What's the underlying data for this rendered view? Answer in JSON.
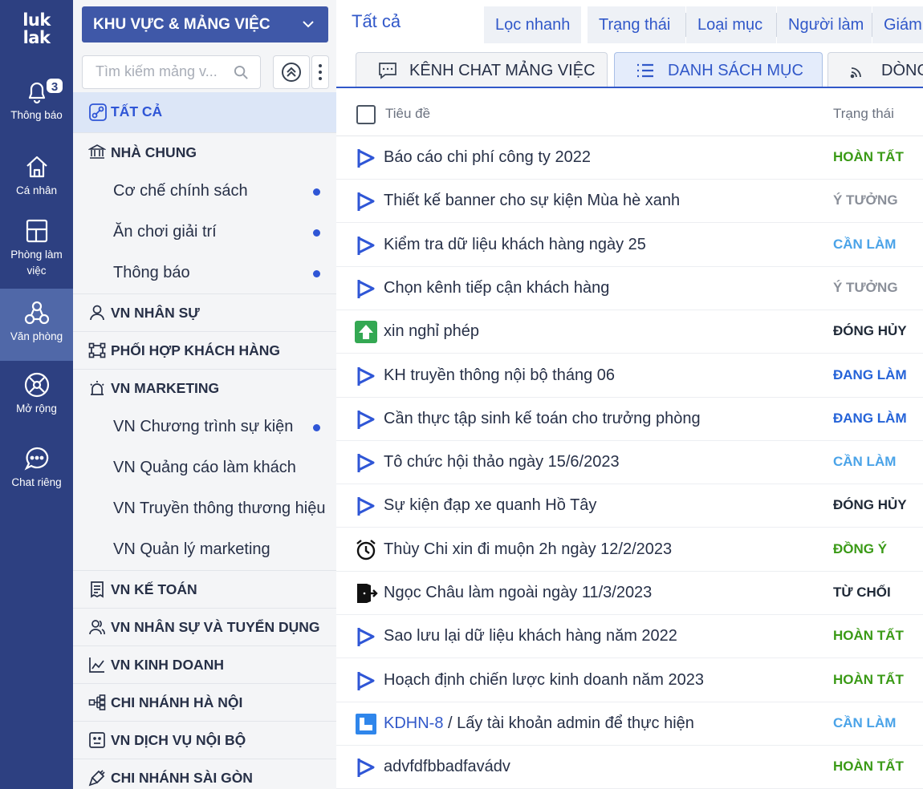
{
  "rail": {
    "logo_line1": "luk",
    "logo_line2": "lak",
    "notifications_badge": "3",
    "items": [
      {
        "label": "Thông báo",
        "icon": "bell-icon"
      },
      {
        "label": "Cá nhân",
        "icon": "home-icon"
      },
      {
        "label": "Phòng làm việc",
        "label_line1": "Phòng làm",
        "label_line2": "việc",
        "icon": "workspace-icon"
      },
      {
        "label": "Văn phòng",
        "icon": "office-icon",
        "active": true
      },
      {
        "label": "Mở rộng",
        "icon": "extend-icon"
      },
      {
        "label": "Chat riêng",
        "icon": "chat-icon"
      }
    ]
  },
  "sidebar": {
    "area_select_label": "KHU VỰC & MẢNG VIỆC",
    "search_placeholder": "Tìm kiếm mảng v...",
    "tree": [
      {
        "type": "group",
        "label": "TẤT CẢ",
        "icon": "link-icon",
        "selected": true
      },
      {
        "type": "group",
        "label": "NHÀ CHUNG",
        "icon": "bank-icon"
      },
      {
        "type": "child",
        "label": "Cơ chế chính sách",
        "dot": true
      },
      {
        "type": "child",
        "label": "Ăn chơi giải trí",
        "dot": true
      },
      {
        "type": "child",
        "label": "Thông báo",
        "dot": true
      },
      {
        "type": "group",
        "label": "VN NHÂN SỰ",
        "icon": "user-icon"
      },
      {
        "type": "group",
        "label": "PHỐI HỢP KHÁCH HÀNG",
        "icon": "collab-icon"
      },
      {
        "type": "group",
        "label": "VN MARKETING",
        "icon": "alarm-light-icon"
      },
      {
        "type": "child",
        "label": "VN Chương trình sự kiện",
        "dot": true
      },
      {
        "type": "child",
        "label": "VN Quảng cáo làm khách",
        "dot": false
      },
      {
        "type": "child",
        "label": "VN Truyền thông thương hiệu",
        "dot": false
      },
      {
        "type": "child",
        "label": "VN Quản lý marketing",
        "dot": false
      },
      {
        "type": "group",
        "label": "VN KẾ TOÁN",
        "icon": "receipt-icon"
      },
      {
        "type": "group",
        "label": "VN NHÂN SỰ VÀ TUYỂN DỤNG",
        "icon": "users-icon"
      },
      {
        "type": "group",
        "label": "VN KINH DOANH",
        "icon": "chart-line-icon"
      },
      {
        "type": "group",
        "label": "CHI NHÁNH HÀ NỘI",
        "icon": "org-chart-icon"
      },
      {
        "type": "group",
        "label": "VN DỊCH VỤ NỘI BỘ",
        "icon": "service-icon"
      },
      {
        "type": "group",
        "label": "CHI NHÁNH SÀI GÒN",
        "icon": "plug-icon"
      }
    ]
  },
  "main": {
    "filter_title": "Tất cả",
    "filters": [
      "Lọc nhanh",
      "Trạng thái",
      "Loại mục",
      "Người làm",
      "Giám"
    ],
    "tabs": [
      {
        "label": "KÊNH CHAT MẢNG VIỆC",
        "icon": "chat-box-icon"
      },
      {
        "label": "DANH SÁCH MỤC",
        "icon": "list-icon",
        "active": true
      },
      {
        "label": "DÒNG",
        "icon": "feed-icon"
      }
    ],
    "columns": {
      "title": "Tiêu đề",
      "status": "Trạng thái"
    },
    "rows": [
      {
        "icon": "play-flag-icon",
        "title": "Báo cáo chi phí công ty 2022",
        "status": "HOÀN TẤT",
        "status_color": "#3a9a16"
      },
      {
        "icon": "play-flag-icon",
        "title": "Thiết kế banner cho sự kiện Mùa hè xanh",
        "status": "Ý TƯỞNG",
        "status_color": "#8a8f99"
      },
      {
        "icon": "play-flag-icon",
        "title": "Kiểm tra dữ liệu khách hàng ngày 25",
        "status": "CẦN LÀM",
        "status_color": "#4aa3e8"
      },
      {
        "icon": "play-flag-icon",
        "title": "Chọn kênh tiếp cận khách hàng",
        "status": "Ý TƯỞNG",
        "status_color": "#8a8f99"
      },
      {
        "icon": "arrow-up-green-icon",
        "title": "xin nghỉ phép",
        "status": "ĐÓNG HỦY",
        "status_color": "#1f2937"
      },
      {
        "icon": "play-flag-icon",
        "title": "KH truyền thông nội bộ tháng 06",
        "status": "ĐANG LÀM",
        "status_color": "#2563d8"
      },
      {
        "icon": "play-flag-icon",
        "title": "Cần thực tập sinh kế toán cho trưởng phòng",
        "status": "ĐANG LÀM",
        "status_color": "#2563d8"
      },
      {
        "icon": "play-flag-icon",
        "title": "Tô chức hội thảo ngày 15/6/2023",
        "status": "CẦN LÀM",
        "status_color": "#4aa3e8"
      },
      {
        "icon": "play-flag-icon",
        "title": "Sự kiện đạp xe quanh Hồ Tây",
        "status": "ĐÓNG HỦY",
        "status_color": "#1f2937"
      },
      {
        "icon": "alarm-clock-icon",
        "title": "Thùy Chi xin đi muộn 2h ngày 12/2/2023",
        "status": "ĐỒNG Ý",
        "status_color": "#3a9a16"
      },
      {
        "icon": "door-exit-icon",
        "title": "Ngọc Châu làm ngoài ngày 11/3/2023",
        "status": "TỪ CHỐI",
        "status_color": "#1f2937"
      },
      {
        "icon": "play-flag-icon",
        "title": "Sao lưu lại dữ liệu khách hàng năm 2022",
        "status": "HOÀN TẤT",
        "status_color": "#3a9a16"
      },
      {
        "icon": "play-flag-icon",
        "title": "Hoạch định chiến lược kinh doanh năm 2023",
        "status": "HOÀN TẤT",
        "status_color": "#3a9a16"
      },
      {
        "icon": "jira-square-icon",
        "key": "KDHN-8",
        "title": " / Lấy tài khoản admin để thực hiện",
        "status": "CẦN LÀM",
        "status_color": "#4aa3e8"
      },
      {
        "icon": "play-flag-icon",
        "title": "advfdfbbadfavádv",
        "status": "HOÀN TẤT",
        "status_color": "#3a9a16"
      }
    ]
  },
  "colors": {
    "rail_bg": "#2d4081",
    "rail_active": "#5068a8",
    "accent_blue": "#3158c9",
    "selected_bg": "#dce6f7"
  }
}
